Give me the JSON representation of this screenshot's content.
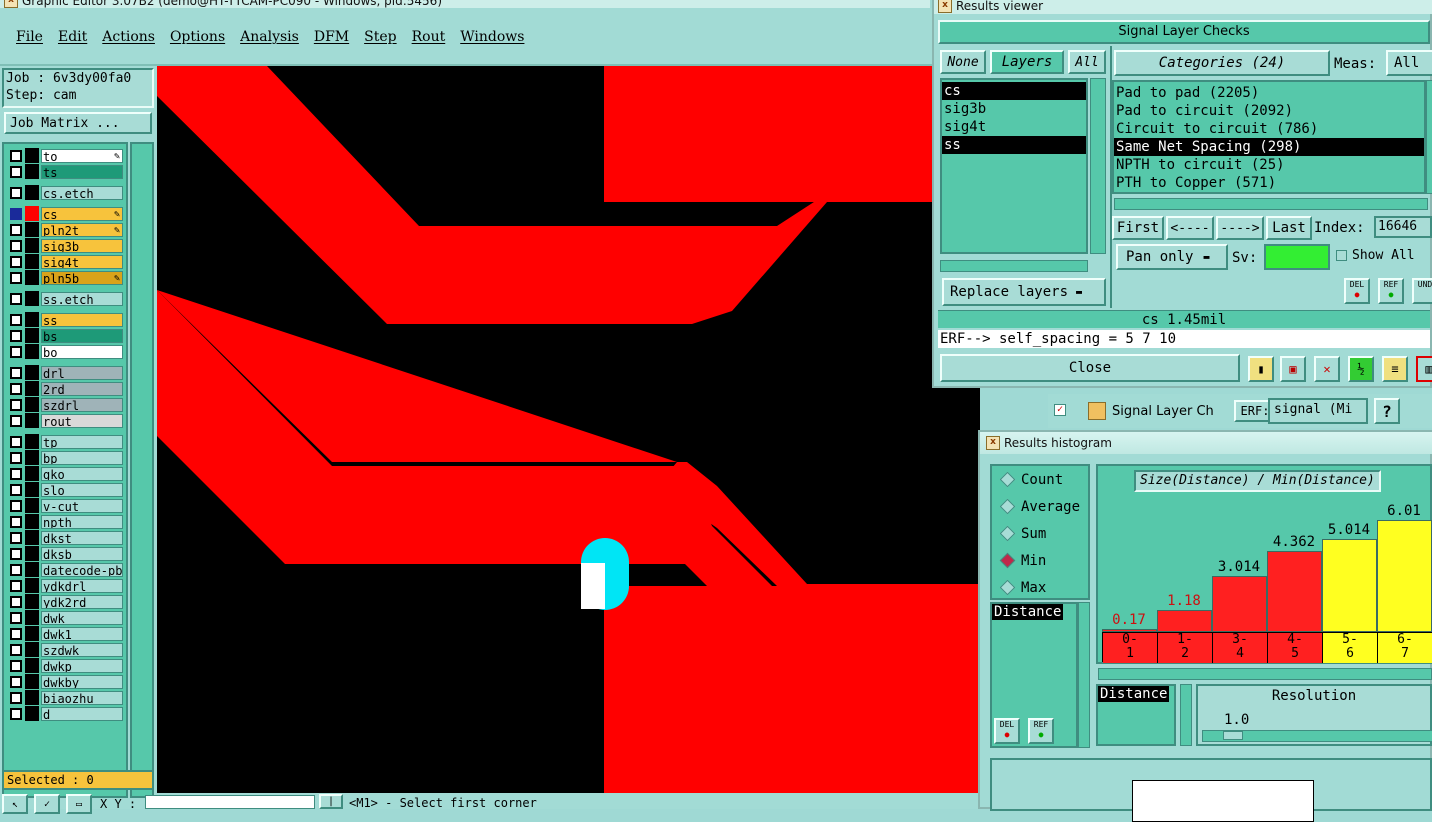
{
  "main_window": {
    "title": "Graphic Editor 3.07B2 (demo@HT-TTCAM-PC090 - Windows, pid:5456)",
    "menu": [
      "File",
      "Edit",
      "Actions",
      "Options",
      "Analysis",
      "DFM",
      "Step",
      "Rout",
      "Windows"
    ],
    "job_label": "Job : 6v3dy00fa0",
    "step_label": "Step: cam",
    "job_matrix_button": "Job Matrix ...",
    "selected_label": "Selected : 0",
    "coord_label": "X Y :",
    "prompt_text": "<M1> - Select first corner"
  },
  "layers": [
    {
      "name": "to",
      "fill": "#ffffff",
      "swatch": "#000000",
      "flag": "✎"
    },
    {
      "name": "ts",
      "fill": "#1e9a78",
      "swatch": "#000000",
      "flag": ""
    },
    {
      "name": "cs.etch",
      "fill": "#a8dcd6",
      "swatch": "#000000",
      "flag": ""
    },
    {
      "name": "cs",
      "fill": "#f7c33c",
      "swatch": "#ff0000",
      "flag": "✎",
      "active": true
    },
    {
      "name": "pln2t",
      "fill": "#f7c33c",
      "swatch": "#000000",
      "flag": "✎"
    },
    {
      "name": "sig3b",
      "fill": "#f7c33c",
      "swatch": "#000000",
      "flag": ""
    },
    {
      "name": "sig4t",
      "fill": "#f7c33c",
      "swatch": "#000000",
      "flag": ""
    },
    {
      "name": "pln5b",
      "fill": "#d9a31a",
      "swatch": "#000000",
      "flag": "✎"
    },
    {
      "name": "ss.etch",
      "fill": "#a8dcd6",
      "swatch": "#000000",
      "flag": ""
    },
    {
      "name": "ss",
      "fill": "#f7c33c",
      "swatch": "#000000",
      "flag": ""
    },
    {
      "name": "bs",
      "fill": "#1e9a78",
      "swatch": "#000000",
      "flag": ""
    },
    {
      "name": "bo",
      "fill": "#ffffff",
      "swatch": "#000000",
      "flag": ""
    },
    {
      "name": "drl",
      "fill": "#9fb3b8",
      "swatch": "#000000",
      "flag": ""
    },
    {
      "name": "2rd",
      "fill": "#9fb3b8",
      "swatch": "#000000",
      "flag": ""
    },
    {
      "name": "szdrl",
      "fill": "#9fb3b8",
      "swatch": "#000000",
      "flag": ""
    },
    {
      "name": "rout",
      "fill": "#d9d9d9",
      "swatch": "#000000",
      "flag": ""
    },
    {
      "name": "tp",
      "fill": "#a8dcd6",
      "swatch": "#000000",
      "flag": ""
    },
    {
      "name": "bp",
      "fill": "#a8dcd6",
      "swatch": "#000000",
      "flag": ""
    },
    {
      "name": "gko",
      "fill": "#a8dcd6",
      "swatch": "#000000",
      "flag": ""
    },
    {
      "name": "slo",
      "fill": "#a8dcd6",
      "swatch": "#000000",
      "flag": ""
    },
    {
      "name": "v-cut",
      "fill": "#a8dcd6",
      "swatch": "#000000",
      "flag": ""
    },
    {
      "name": "npth",
      "fill": "#a8dcd6",
      "swatch": "#000000",
      "flag": ""
    },
    {
      "name": "dkst",
      "fill": "#a8dcd6",
      "swatch": "#000000",
      "flag": ""
    },
    {
      "name": "dksb",
      "fill": "#a8dcd6",
      "swatch": "#000000",
      "flag": ""
    },
    {
      "name": "datecode-pbe",
      "fill": "#a8dcd6",
      "swatch": "#000000",
      "flag": ""
    },
    {
      "name": "ydkdrl",
      "fill": "#a8dcd6",
      "swatch": "#000000",
      "flag": ""
    },
    {
      "name": "ydk2rd",
      "fill": "#a8dcd6",
      "swatch": "#000000",
      "flag": ""
    },
    {
      "name": "dwk",
      "fill": "#a8dcd6",
      "swatch": "#000000",
      "flag": ""
    },
    {
      "name": "dwk1",
      "fill": "#a8dcd6",
      "swatch": "#000000",
      "flag": ""
    },
    {
      "name": "szdwk",
      "fill": "#a8dcd6",
      "swatch": "#000000",
      "flag": ""
    },
    {
      "name": "dwkp",
      "fill": "#a8dcd6",
      "swatch": "#000000",
      "flag": ""
    },
    {
      "name": "dwkby",
      "fill": "#a8dcd6",
      "swatch": "#000000",
      "flag": ""
    },
    {
      "name": "biaozhu",
      "fill": "#a8dcd6",
      "swatch": "#000000",
      "flag": ""
    },
    {
      "name": "d",
      "fill": "#a8dcd6",
      "swatch": "#000000",
      "flag": ""
    }
  ],
  "results_viewer": {
    "title": "Results viewer",
    "header": "Signal Layer Checks",
    "none_button": "None",
    "layers_button": "Layers",
    "all_button": "All",
    "layers_list": [
      "cs",
      "sig3b",
      "sig4t",
      "ss"
    ],
    "categories_button": "Categories (24)",
    "meas_label": "Meas:",
    "meas_value": "All",
    "categories": [
      "Pad to pad (2205)",
      "Pad to circuit (2092)",
      "Circuit to circuit (786)",
      "Same Net Spacing (298)",
      "NPTH to circuit (25)",
      "PTH to Copper (571)"
    ],
    "selected_category_index": 3,
    "first_button": "First",
    "prev_button": "<----",
    "next_button": "---->",
    "last_button": "Last",
    "index_label": "Index:",
    "index_value": "16646",
    "pan_mode": "Pan only",
    "sv_label": "Sv:",
    "show_all_label": "Show All",
    "replace_layers": "Replace layers",
    "status_line": "cs 1.45mil",
    "erf_line": "ERF--> self_spacing = 5 7 10",
    "close_button": "Close",
    "del_label": "DEL",
    "ref_label": "REF",
    "und_label": "UND"
  },
  "signal_layer_bar": {
    "title": "Signal Layer Ch",
    "erf_label": "ERF:",
    "erf_value": "signal (Mi",
    "help": "?"
  },
  "histogram": {
    "title": "Results histogram",
    "modes": [
      "Count",
      "Average",
      "Sum",
      "Min",
      "Max"
    ],
    "selected_mode": "Min",
    "distance_label": "Distance",
    "chart_title": "Size(Distance) / Min(Distance)",
    "distance_label2": "Distance",
    "resolution_label": "Resolution",
    "resolution_value": "1.0",
    "del_label": "DEL",
    "ref_label": "REF"
  },
  "chart_data": {
    "type": "bar",
    "title": "Size(Distance) / Min(Distance)",
    "categories": [
      "0-1",
      "1-2",
      "3-4",
      "4-5",
      "5-6",
      "6-7"
    ],
    "values": [
      0.17,
      1.18,
      3.014,
      4.362,
      5.014,
      6.01
    ],
    "labels": [
      "0.17",
      "1.18",
      "3.014",
      "4.362",
      "5.014",
      "6.01"
    ],
    "colors": [
      "#ff2020",
      "#ff2020",
      "#ff2020",
      "#ff2020",
      "#ffff20",
      "#ffff20"
    ],
    "label_colors": [
      "#cc1010",
      "#cc1010",
      "#000000",
      "#000000",
      "#000000",
      "#000000"
    ],
    "ylim": [
      0,
      6.6
    ],
    "bins_top": [
      "0-",
      "1-",
      "3-",
      "4-",
      "5-",
      "6-"
    ],
    "bins_bottom": [
      "1",
      "2",
      "4",
      "5",
      "6",
      "7"
    ]
  }
}
